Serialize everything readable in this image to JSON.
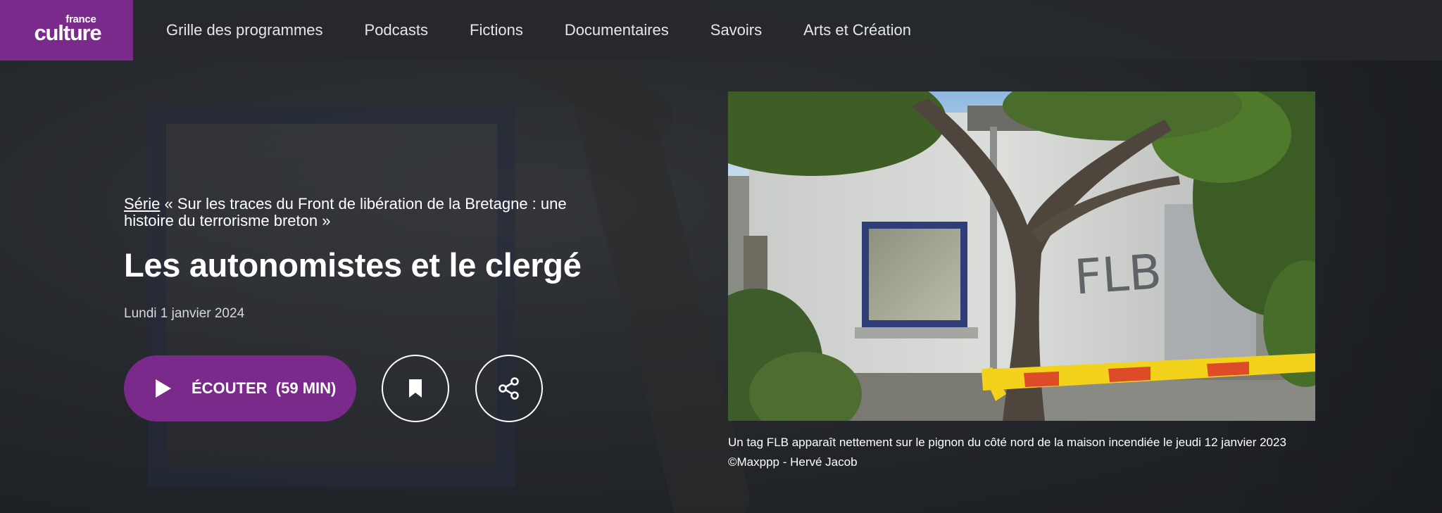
{
  "logo": {
    "small": "france",
    "big": "culture"
  },
  "nav": {
    "items": [
      {
        "label": "Grille des programmes"
      },
      {
        "label": "Podcasts"
      },
      {
        "label": "Fictions"
      },
      {
        "label": "Documentaires"
      },
      {
        "label": "Savoirs"
      },
      {
        "label": "Arts et Création"
      }
    ]
  },
  "episode": {
    "series_link": "Série",
    "series_title": " « Sur les traces du Front de libération de la Bretagne : une histoire du terrorisme breton »",
    "title": "Les autonomistes et le clergé",
    "date": "Lundi 1 janvier 2024"
  },
  "actions": {
    "listen_label": "ÉCOUTER  (59 MIN)"
  },
  "photo": {
    "tag_text": "FLB",
    "caption_line1": "Un tag FLB apparaît nettement sur le pignon du côté nord de la maison incendiée le jeudi 12 janvier 2023",
    "caption_line2": "©Maxppp - Hervé Jacob"
  },
  "colors": {
    "brand_purple": "#7a2a8b",
    "nav_bg": "#26282c",
    "tape_yellow": "#f2d21b",
    "tape_red": "#d9342b"
  },
  "icons": {
    "play": "play-icon",
    "bookmark": "bookmark-icon",
    "share": "share-icon"
  }
}
